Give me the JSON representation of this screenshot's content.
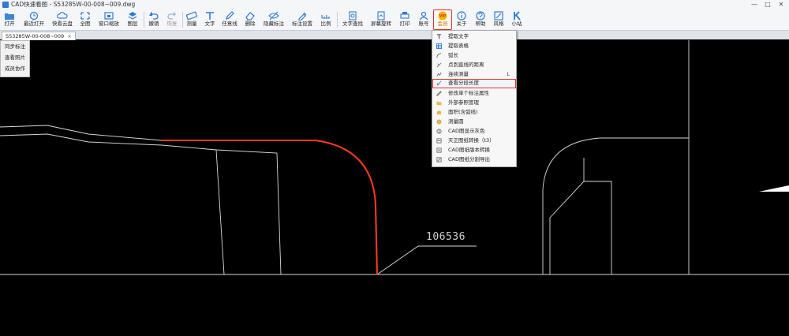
{
  "window": {
    "title": "CAD快速看图 - S53285W-00-008~009.dwg",
    "controls": [
      "—",
      "□",
      "✕"
    ]
  },
  "toolbar": {
    "buttons": [
      {
        "label": "打开",
        "icon": "folder-icon"
      },
      {
        "label": "最近打开",
        "icon": "clock-icon"
      },
      {
        "label": "快看云盘",
        "icon": "cloud-icon"
      },
      {
        "label": "全图",
        "icon": "fit-view-icon"
      },
      {
        "label": "窗口缩放",
        "icon": "window-zoom-icon"
      },
      {
        "label": "图层",
        "icon": "layers-icon"
      },
      {
        "label": "撤销",
        "icon": "undo-icon"
      },
      {
        "label": "恢复",
        "icon": "redo-icon"
      },
      {
        "label": "测量",
        "icon": "ruler-icon"
      },
      {
        "label": "文字",
        "icon": "text-icon"
      },
      {
        "label": "任意线",
        "icon": "pencil-icon"
      },
      {
        "label": "删除",
        "icon": "eraser-icon"
      },
      {
        "label": "隐藏标注",
        "icon": "eye-hide-icon"
      },
      {
        "label": "标注设置",
        "icon": "settings-icon"
      },
      {
        "label": "比例",
        "icon": "scale-icon"
      },
      {
        "label": "文字查找",
        "icon": "find-text-icon"
      },
      {
        "label": "屏幕旋转",
        "icon": "rotate-screen-icon"
      },
      {
        "label": "打印",
        "icon": "printer-icon"
      },
      {
        "label": "账号",
        "icon": "user-icon"
      },
      {
        "label": "会员",
        "icon": "vip-icon",
        "badge": "VIP"
      },
      {
        "label": "关于",
        "icon": "info-icon"
      },
      {
        "label": "帮助",
        "icon": "help-icon"
      },
      {
        "label": "风格",
        "icon": "style-icon"
      },
      {
        "label": "小站",
        "icon": "k-icon"
      }
    ]
  },
  "tabs": [
    {
      "label": "S53285W-00-008~009",
      "close": "×"
    }
  ],
  "left_panel": {
    "items": [
      "同步标注",
      "查看照片",
      "成员协作"
    ]
  },
  "vip_menu": {
    "items": [
      {
        "label": "提取文字"
      },
      {
        "label": "提取表格"
      },
      {
        "label": "弧长"
      },
      {
        "label": "点到直线的距离"
      },
      {
        "label": "连续测量",
        "shortcut": "L"
      },
      {
        "label": "查看分段长度",
        "highlighted": true
      },
      {
        "label": "修改单个标注属性"
      },
      {
        "label": "外部参照管理"
      },
      {
        "label": "面积(含弧线)"
      },
      {
        "label": "测量圆"
      },
      {
        "label": "CAD图显示灰色"
      },
      {
        "label": "天正图纸转换（t3）"
      },
      {
        "label": "CAD图纸版本转换"
      },
      {
        "label": "CAD图纸分割导出"
      }
    ]
  },
  "drawing": {
    "dimension_text": "106536",
    "colors": {
      "lines": "#d9d9d9",
      "highlight": "#ff3b1f",
      "background": "#000000"
    }
  },
  "colors": {
    "toolbar_bg": "#f4f6f8",
    "accent_red": "#e03030",
    "icon_blue": "#2e7bd6"
  }
}
